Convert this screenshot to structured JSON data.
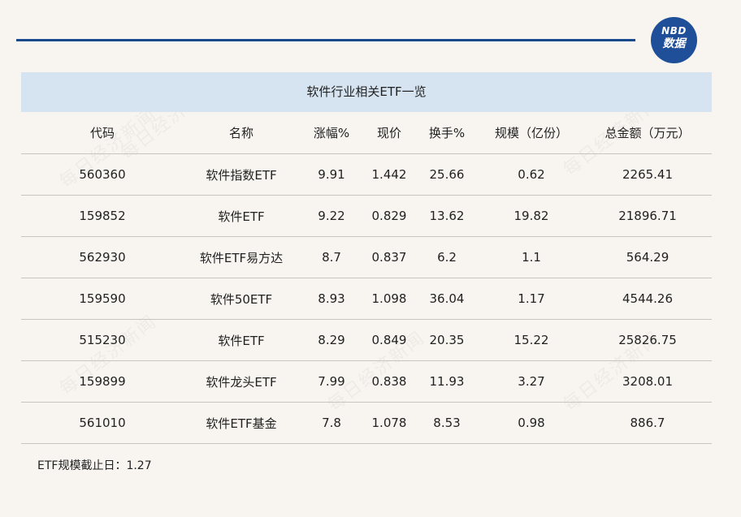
{
  "brand": {
    "logo_line1": "NBD",
    "logo_line2": "数据"
  },
  "table": {
    "title": "软件行业相关ETF一览",
    "headers": [
      "代码",
      "名称",
      "涨幅%",
      "现价",
      "换手%",
      "规模（亿份）",
      "总金额（万元）"
    ],
    "rows": [
      [
        "560360",
        "软件指数ETF",
        "9.91",
        "1.442",
        "25.66",
        "0.62",
        "2265.41"
      ],
      [
        "159852",
        "软件ETF",
        "9.22",
        "0.829",
        "13.62",
        "19.82",
        "21896.71"
      ],
      [
        "562930",
        "软件ETF易方达",
        "8.7",
        "0.837",
        "6.2",
        "1.1",
        "564.29"
      ],
      [
        "159590",
        "软件50ETF",
        "8.93",
        "1.098",
        "36.04",
        "1.17",
        "4544.26"
      ],
      [
        "515230",
        "软件ETF",
        "8.29",
        "0.849",
        "20.35",
        "15.22",
        "25826.75"
      ],
      [
        "159899",
        "软件龙头ETF",
        "7.99",
        "0.838",
        "11.93",
        "3.27",
        "3208.01"
      ],
      [
        "561010",
        "软件ETF基金",
        "7.8",
        "1.078",
        "8.53",
        "0.98",
        "886.7"
      ]
    ]
  },
  "note": "ETF规模截止日：1.27",
  "watermark": "每日经济新闻",
  "colors": {
    "accent": "#1a4a8e",
    "title_band": "#d6e4f1",
    "background": "#f8f5f1"
  }
}
